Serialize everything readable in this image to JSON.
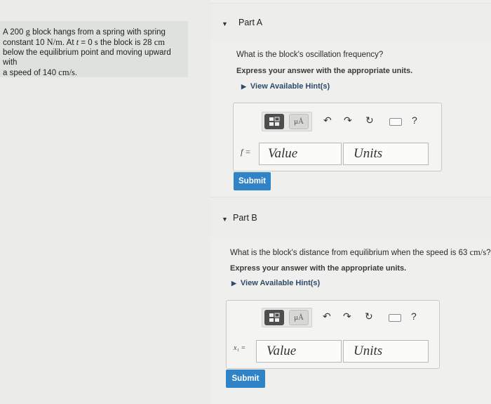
{
  "problem": {
    "line1_a": "A 200 ",
    "line1_b": "g",
    "line1_c": " block hangs from a spring with spring",
    "line2_a": "constant 10 ",
    "line2_b": "N/m",
    "line2_c": ". At ",
    "line2_d": "t",
    "line2_e": " = 0 ",
    "line2_f": "s",
    "line2_g": " the block is 28 ",
    "line2_h": "cm",
    "line3": "below the equilibrium point and moving upward with",
    "line4_a": "a speed of 140 ",
    "line4_b": "cm/s",
    "line4_c": "."
  },
  "partA": {
    "title": "Part A",
    "question": "What is the block's oscillation frequency?",
    "instruction": "Express your answer with the appropriate units.",
    "hint": "View Available Hint(s)",
    "var_label": "f =",
    "value_placeholder": "Value",
    "units_placeholder": "Units",
    "submit": "Submit"
  },
  "partB": {
    "title": "Part B",
    "question_a": "What is the block's distance from equilibrium when the speed is 63 ",
    "question_b": "cm/s",
    "question_c": "?",
    "instruction": "Express your answer with the appropriate units.",
    "hint": "View Available Hint(s)",
    "var_label": "x₁ =",
    "value_placeholder": "Value",
    "units_placeholder": "Units",
    "submit": "Submit"
  },
  "toolbar": {
    "mu_label": "μÅ",
    "help": "?",
    "undo": "↶",
    "redo": "↷",
    "reset": "↻"
  }
}
